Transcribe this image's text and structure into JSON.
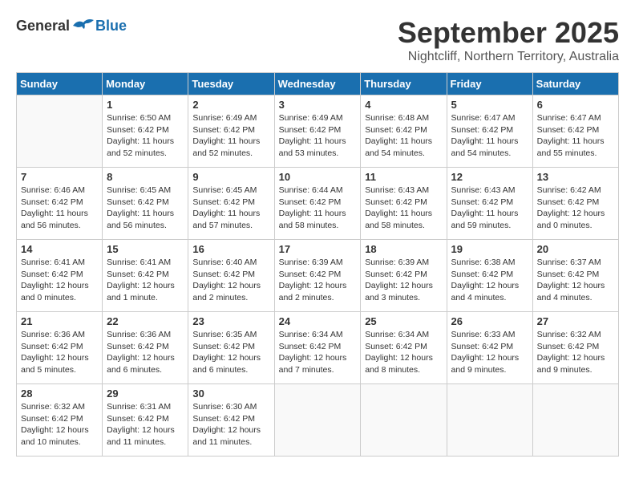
{
  "logo": {
    "general": "General",
    "blue": "Blue"
  },
  "header": {
    "month": "September 2025",
    "location": "Nightcliff, Northern Territory, Australia"
  },
  "weekdays": [
    "Sunday",
    "Monday",
    "Tuesday",
    "Wednesday",
    "Thursday",
    "Friday",
    "Saturday"
  ],
  "weeks": [
    [
      {
        "day": "",
        "info": ""
      },
      {
        "day": "1",
        "info": "Sunrise: 6:50 AM\nSunset: 6:42 PM\nDaylight: 11 hours\nand 52 minutes."
      },
      {
        "day": "2",
        "info": "Sunrise: 6:49 AM\nSunset: 6:42 PM\nDaylight: 11 hours\nand 52 minutes."
      },
      {
        "day": "3",
        "info": "Sunrise: 6:49 AM\nSunset: 6:42 PM\nDaylight: 11 hours\nand 53 minutes."
      },
      {
        "day": "4",
        "info": "Sunrise: 6:48 AM\nSunset: 6:42 PM\nDaylight: 11 hours\nand 54 minutes."
      },
      {
        "day": "5",
        "info": "Sunrise: 6:47 AM\nSunset: 6:42 PM\nDaylight: 11 hours\nand 54 minutes."
      },
      {
        "day": "6",
        "info": "Sunrise: 6:47 AM\nSunset: 6:42 PM\nDaylight: 11 hours\nand 55 minutes."
      }
    ],
    [
      {
        "day": "7",
        "info": "Sunrise: 6:46 AM\nSunset: 6:42 PM\nDaylight: 11 hours\nand 56 minutes."
      },
      {
        "day": "8",
        "info": "Sunrise: 6:45 AM\nSunset: 6:42 PM\nDaylight: 11 hours\nand 56 minutes."
      },
      {
        "day": "9",
        "info": "Sunrise: 6:45 AM\nSunset: 6:42 PM\nDaylight: 11 hours\nand 57 minutes."
      },
      {
        "day": "10",
        "info": "Sunrise: 6:44 AM\nSunset: 6:42 PM\nDaylight: 11 hours\nand 58 minutes."
      },
      {
        "day": "11",
        "info": "Sunrise: 6:43 AM\nSunset: 6:42 PM\nDaylight: 11 hours\nand 58 minutes."
      },
      {
        "day": "12",
        "info": "Sunrise: 6:43 AM\nSunset: 6:42 PM\nDaylight: 11 hours\nand 59 minutes."
      },
      {
        "day": "13",
        "info": "Sunrise: 6:42 AM\nSunset: 6:42 PM\nDaylight: 12 hours\nand 0 minutes."
      }
    ],
    [
      {
        "day": "14",
        "info": "Sunrise: 6:41 AM\nSunset: 6:42 PM\nDaylight: 12 hours\nand 0 minutes."
      },
      {
        "day": "15",
        "info": "Sunrise: 6:41 AM\nSunset: 6:42 PM\nDaylight: 12 hours\nand 1 minute."
      },
      {
        "day": "16",
        "info": "Sunrise: 6:40 AM\nSunset: 6:42 PM\nDaylight: 12 hours\nand 2 minutes."
      },
      {
        "day": "17",
        "info": "Sunrise: 6:39 AM\nSunset: 6:42 PM\nDaylight: 12 hours\nand 2 minutes."
      },
      {
        "day": "18",
        "info": "Sunrise: 6:39 AM\nSunset: 6:42 PM\nDaylight: 12 hours\nand 3 minutes."
      },
      {
        "day": "19",
        "info": "Sunrise: 6:38 AM\nSunset: 6:42 PM\nDaylight: 12 hours\nand 4 minutes."
      },
      {
        "day": "20",
        "info": "Sunrise: 6:37 AM\nSunset: 6:42 PM\nDaylight: 12 hours\nand 4 minutes."
      }
    ],
    [
      {
        "day": "21",
        "info": "Sunrise: 6:36 AM\nSunset: 6:42 PM\nDaylight: 12 hours\nand 5 minutes."
      },
      {
        "day": "22",
        "info": "Sunrise: 6:36 AM\nSunset: 6:42 PM\nDaylight: 12 hours\nand 6 minutes."
      },
      {
        "day": "23",
        "info": "Sunrise: 6:35 AM\nSunset: 6:42 PM\nDaylight: 12 hours\nand 6 minutes."
      },
      {
        "day": "24",
        "info": "Sunrise: 6:34 AM\nSunset: 6:42 PM\nDaylight: 12 hours\nand 7 minutes."
      },
      {
        "day": "25",
        "info": "Sunrise: 6:34 AM\nSunset: 6:42 PM\nDaylight: 12 hours\nand 8 minutes."
      },
      {
        "day": "26",
        "info": "Sunrise: 6:33 AM\nSunset: 6:42 PM\nDaylight: 12 hours\nand 9 minutes."
      },
      {
        "day": "27",
        "info": "Sunrise: 6:32 AM\nSunset: 6:42 PM\nDaylight: 12 hours\nand 9 minutes."
      }
    ],
    [
      {
        "day": "28",
        "info": "Sunrise: 6:32 AM\nSunset: 6:42 PM\nDaylight: 12 hours\nand 10 minutes."
      },
      {
        "day": "29",
        "info": "Sunrise: 6:31 AM\nSunset: 6:42 PM\nDaylight: 12 hours\nand 11 minutes."
      },
      {
        "day": "30",
        "info": "Sunrise: 6:30 AM\nSunset: 6:42 PM\nDaylight: 12 hours\nand 11 minutes."
      },
      {
        "day": "",
        "info": ""
      },
      {
        "day": "",
        "info": ""
      },
      {
        "day": "",
        "info": ""
      },
      {
        "day": "",
        "info": ""
      }
    ]
  ]
}
